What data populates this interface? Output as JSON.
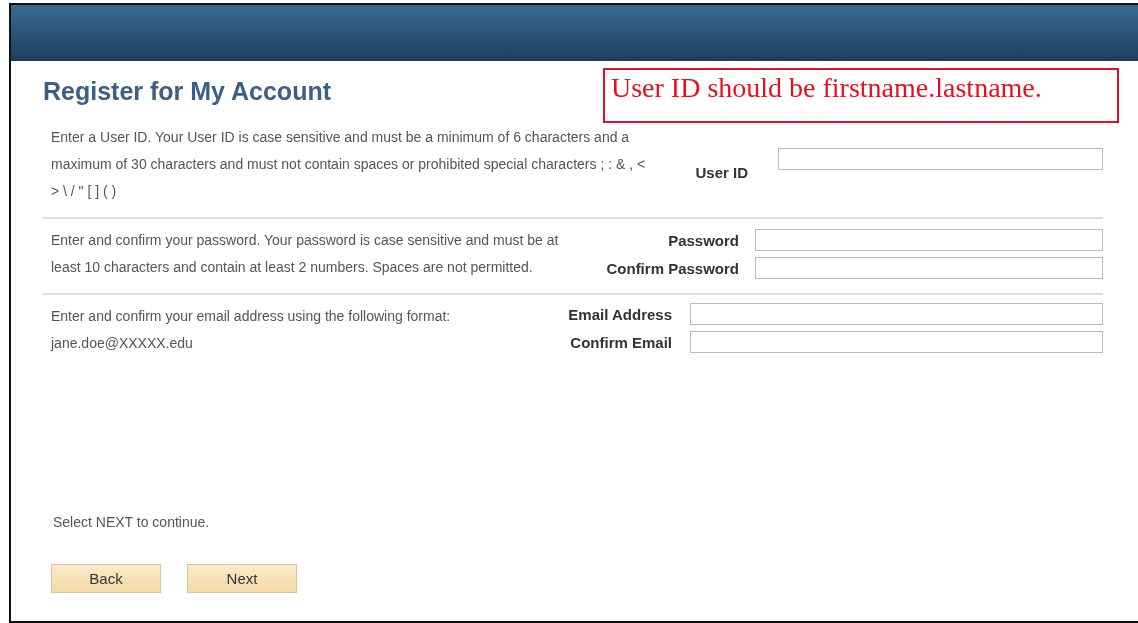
{
  "page": {
    "title": "Register for My Account"
  },
  "callout": {
    "text": "User ID should be firstname.lastname."
  },
  "sections": [
    {
      "description": "Enter a User ID.  Your User ID is case sensitive and must be a minimum of 6 characters and a maximum of 30 characters and must not contain spaces or prohibited special characters  ;  :  &  ,  <  >  \\  /  \"  [  ]  (  )",
      "fields": [
        {
          "label": "User ID"
        }
      ]
    },
    {
      "description": "Enter and confirm your password.  Your password is case sensitive and must be at least 10 characters and contain at least 2 numbers. Spaces are not permitted.",
      "fields": [
        {
          "label": "Password"
        },
        {
          "label": "Confirm Password"
        }
      ]
    },
    {
      "description": "Enter and confirm your email address using the following format: jane.doe@XXXXX.edu",
      "fields": [
        {
          "label": "Email Address"
        },
        {
          "label": "Confirm Email"
        }
      ]
    }
  ],
  "instruction": "Select NEXT to continue.",
  "buttons": [
    "Back",
    "Next"
  ]
}
